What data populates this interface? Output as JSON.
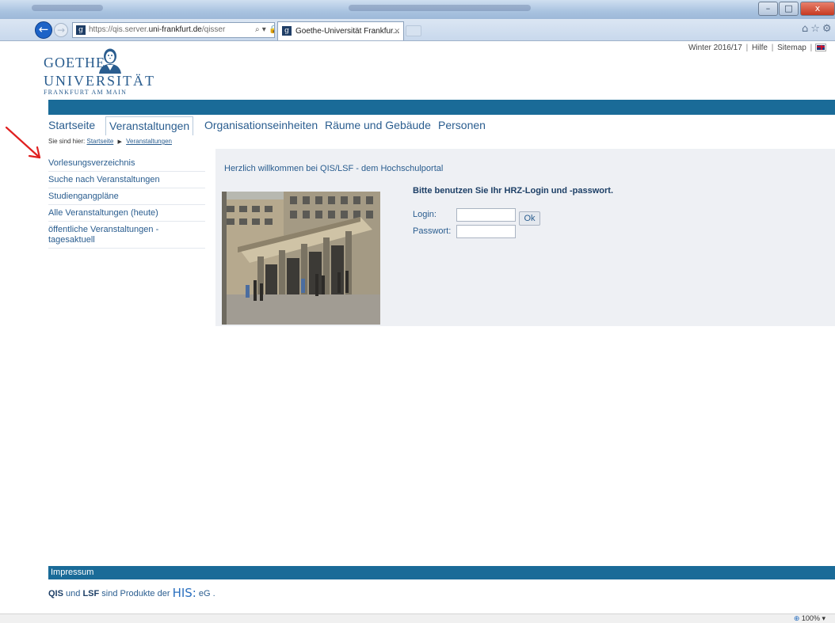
{
  "browser": {
    "address_prefix": "https://",
    "address_host_pre": "qis.server.",
    "address_host": "uni-frankfurt.de",
    "address_path": "/qisser",
    "address_icons": "⌕ ▾ 🔒 ↻",
    "tab_title": "Goethe-Universität Frankfur...",
    "tab_close": "×",
    "favicon_glyph": "g",
    "right_icons": "⌂☆⚙",
    "close_glyph": "x",
    "min_glyph": "–",
    "max_glyph": "□",
    "back_glyph": "←",
    "fwd_glyph": "→"
  },
  "logo": {
    "line1": "GOETHE",
    "line2": "UNIVERSITÄT",
    "line3": "FRANKFURT AM MAIN"
  },
  "toplinks": {
    "semester": "Winter 2016/17",
    "sep": "|",
    "hilfe": "Hilfe",
    "sitemap": "Sitemap"
  },
  "mainnav": {
    "startseite": "Startseite",
    "veranstaltungen": "Veranstaltungen",
    "organisation": "Organisationseinheiten",
    "raeume": "Räume und Gebäude",
    "personen": "Personen"
  },
  "breadcrumb": {
    "prefix": "Sie sind hier:",
    "item1": "Startseite",
    "arrow": "▶",
    "item2": "Veranstaltungen"
  },
  "sidenav": {
    "items": [
      {
        "label": "Vorlesungsverzeichnis"
      },
      {
        "label": "Suche nach Veranstaltungen"
      },
      {
        "label": "Studiengangpläne"
      },
      {
        "label": "Alle Veranstaltungen (heute)"
      },
      {
        "label": "öffentliche Veranstaltungen - tagesaktuell"
      }
    ]
  },
  "content": {
    "welcome": "Herzlich willkommen bei QIS/LSF - dem Hochschulportal",
    "login_hint": "Bitte benutzen Sie Ihr HRZ-Login und -passwort.",
    "login_label": "Login:",
    "password_label": "Passwort:",
    "login_value": "",
    "password_value": "",
    "ok_label": "Ok"
  },
  "footer": {
    "impressum": "Impressum",
    "qis": "QIS",
    "und": "und",
    "lsf": "LSF",
    "sind_produkte": "sind Produkte der",
    "his": "HIS:",
    "eg": "eG ."
  },
  "statusbar": {
    "zoom": "100%",
    "zoom_caret": "▾"
  },
  "colors": {
    "brand_blue": "#1a6b98",
    "link_blue": "#2a5d8f",
    "annotation_red": "#e02020"
  }
}
